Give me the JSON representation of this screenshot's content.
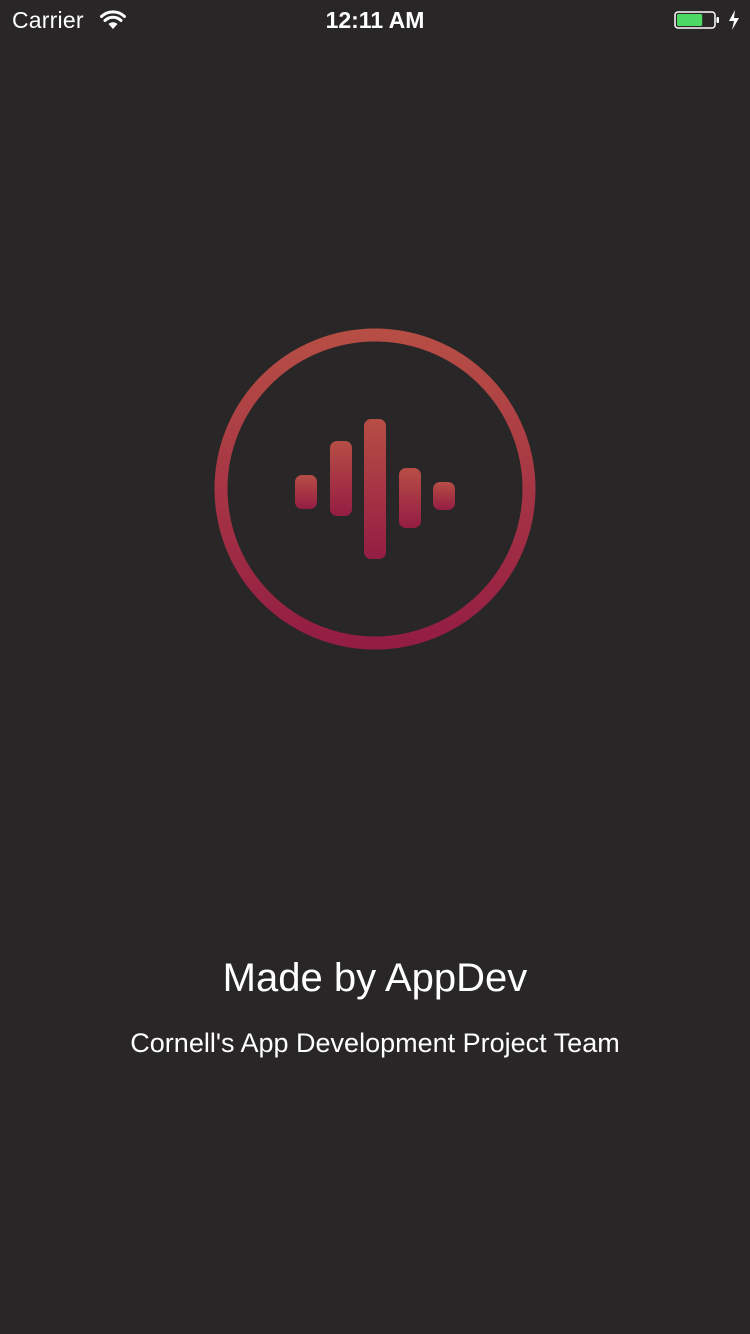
{
  "status_bar": {
    "carrier": "Carrier",
    "time": "12:11 AM",
    "battery_level": 0.7,
    "charging": true
  },
  "logo": {
    "icon": "audio-waveform-icon",
    "gradient_top": "#B74E45",
    "gradient_bottom": "#941D43"
  },
  "credits": {
    "title": "Made by AppDev",
    "subtitle": "Cornell's App Development Project Team"
  },
  "colors": {
    "background": "#292627",
    "text": "#FFFFFF",
    "battery_fill": "#4CD964"
  }
}
